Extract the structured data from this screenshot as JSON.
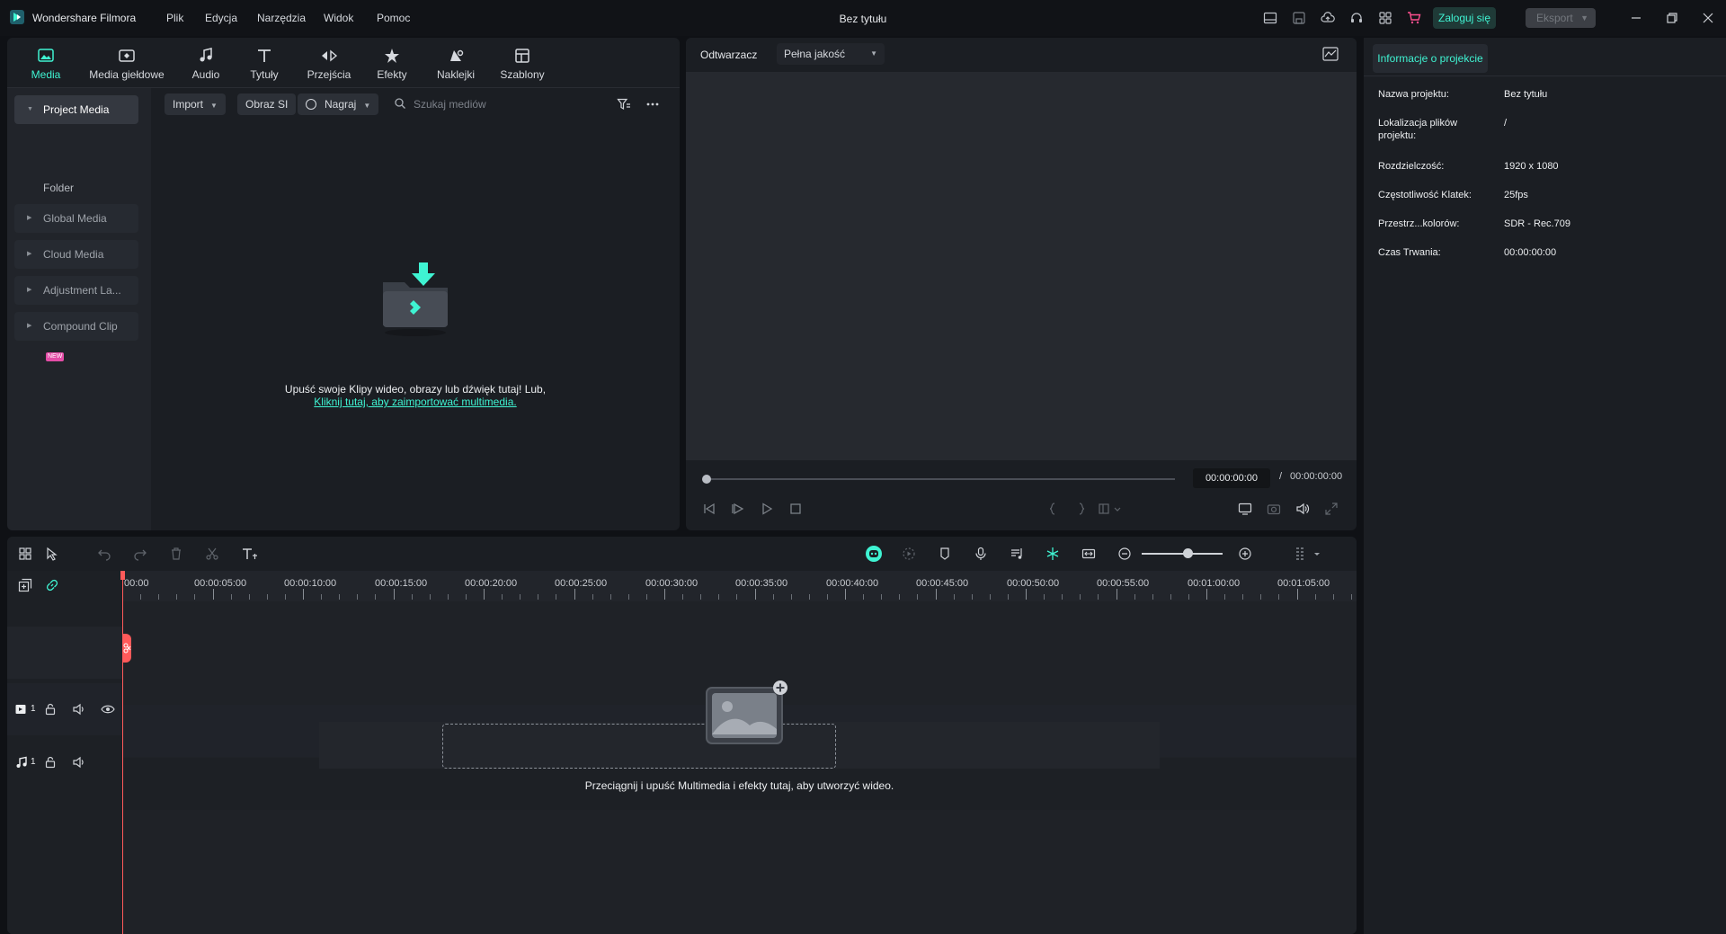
{
  "app": {
    "name": "Wondershare Filmora",
    "document_title": "Bez tytułu",
    "menu": [
      "Plik",
      "Edycja",
      "Narzędzia",
      "Widok",
      "Pomoc"
    ],
    "login_label": "Zaloguj się",
    "export_label": "Eksport"
  },
  "media_tabs": [
    {
      "label": "Media",
      "icon": "media-icon",
      "active": true
    },
    {
      "label": "Media giełdowe",
      "icon": "stock-media-icon"
    },
    {
      "label": "Audio",
      "icon": "music-note-icon"
    },
    {
      "label": "Tytuły",
      "icon": "text-icon"
    },
    {
      "label": "Przejścia",
      "icon": "transitions-icon"
    },
    {
      "label": "Efekty",
      "icon": "effects-icon"
    },
    {
      "label": "Naklejki",
      "icon": "stickers-icon"
    },
    {
      "label": "Szablony",
      "icon": "templates-icon"
    }
  ],
  "sidebar": {
    "items": [
      {
        "label": "Project Media",
        "active": true
      },
      {
        "label": "Folder"
      },
      {
        "label": "Global Media"
      },
      {
        "label": "Cloud Media"
      },
      {
        "label": "Adjustment La..."
      },
      {
        "label": "Compound Clip",
        "badge": "NEW"
      }
    ]
  },
  "media_toolbar": {
    "import_label": "Import",
    "ai_image_label": "Obraz SI",
    "record_label": "Nagraj",
    "search_placeholder": "Szukaj mediów"
  },
  "media_empty": {
    "line1": "Upuść swoje Klipy wideo, obrazy lub dźwięk tutaj! Lub,",
    "link": "Kliknij tutaj, aby zaimportować multimedia."
  },
  "preview": {
    "player_label": "Odtwarzacz",
    "quality": "Pełna jakość",
    "current_time": "00:00:00:00",
    "separator": "/",
    "total_time": "00:00:00:00",
    "progress": 0
  },
  "project_info": {
    "tab_label": "Informacje o projekcie",
    "rows": [
      {
        "label": "Nazwa projektu:",
        "value": "Bez tytułu"
      },
      {
        "label": "Lokalizacja plików projektu:",
        "value": "/"
      },
      {
        "label": "Rozdzielczość:",
        "value": "1920 x 1080"
      },
      {
        "label": "Częstotliwość Klatek:",
        "value": "25fps"
      },
      {
        "label": "Przestrz...kolorów:",
        "value": "SDR - Rec.709"
      },
      {
        "label": "Czas Trwania:",
        "value": "00:00:00:00"
      }
    ]
  },
  "timeline": {
    "ruler_labels": [
      "00:00",
      "00:00:05:00",
      "00:00:10:00",
      "00:00:15:00",
      "00:00:20:00",
      "00:00:25:00",
      "00:00:30:00",
      "00:00:35:00",
      "00:00:40:00",
      "00:00:45:00",
      "00:00:50:00",
      "00:00:55:00",
      "00:01:00:00",
      "00:01:05:00"
    ],
    "video_track_number": "1",
    "audio_track_number": "1",
    "drop_text": "Przeciągnij i upuść Multimedia i efekty tutaj, aby utworzyć wideo.",
    "zoom_level": 0.6
  },
  "colors": {
    "accent": "#3ff3d2",
    "playhead": "#ff5a5a",
    "panel_bg": "#1b1e23",
    "app_bg": "#0f1115"
  }
}
